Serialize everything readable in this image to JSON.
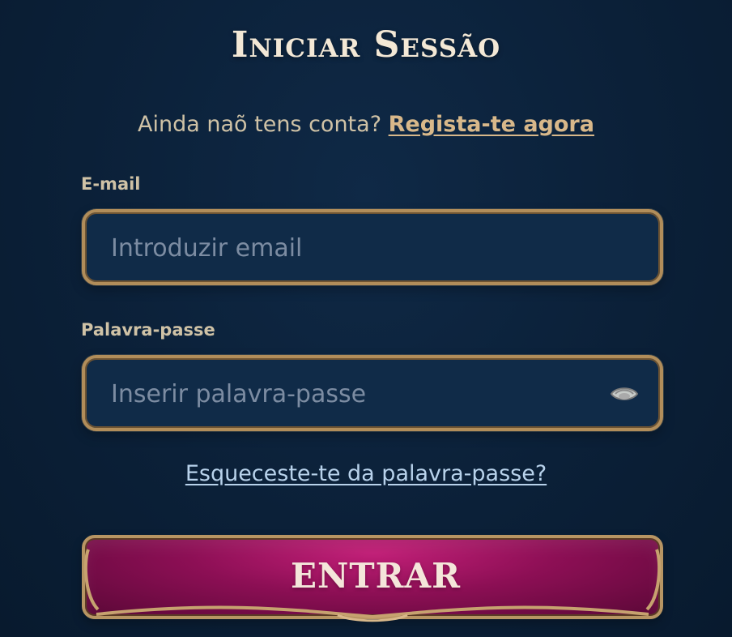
{
  "title": "Iniciar Sessão",
  "signup": {
    "prompt": "Ainda naõ tens conta?",
    "link_label": "Regista-te agora"
  },
  "email": {
    "label": "E-mail",
    "placeholder": "Introduzir email",
    "value": ""
  },
  "password": {
    "label": "Palavra-passe",
    "placeholder": "Inserir palavra-passe",
    "value": "",
    "toggle_icon": "eye-icon"
  },
  "forgot": {
    "label": "Esqueceste-te da palavra-passe?"
  },
  "submit": {
    "label": "ENTRAR"
  },
  "colors": {
    "background": "#0b2038",
    "field_bg": "#102b48",
    "gold": "#b18d5a",
    "button_pink": "#8d0f55",
    "link_blue": "#b8d2eb",
    "text_muted": "#cfc2a6"
  }
}
